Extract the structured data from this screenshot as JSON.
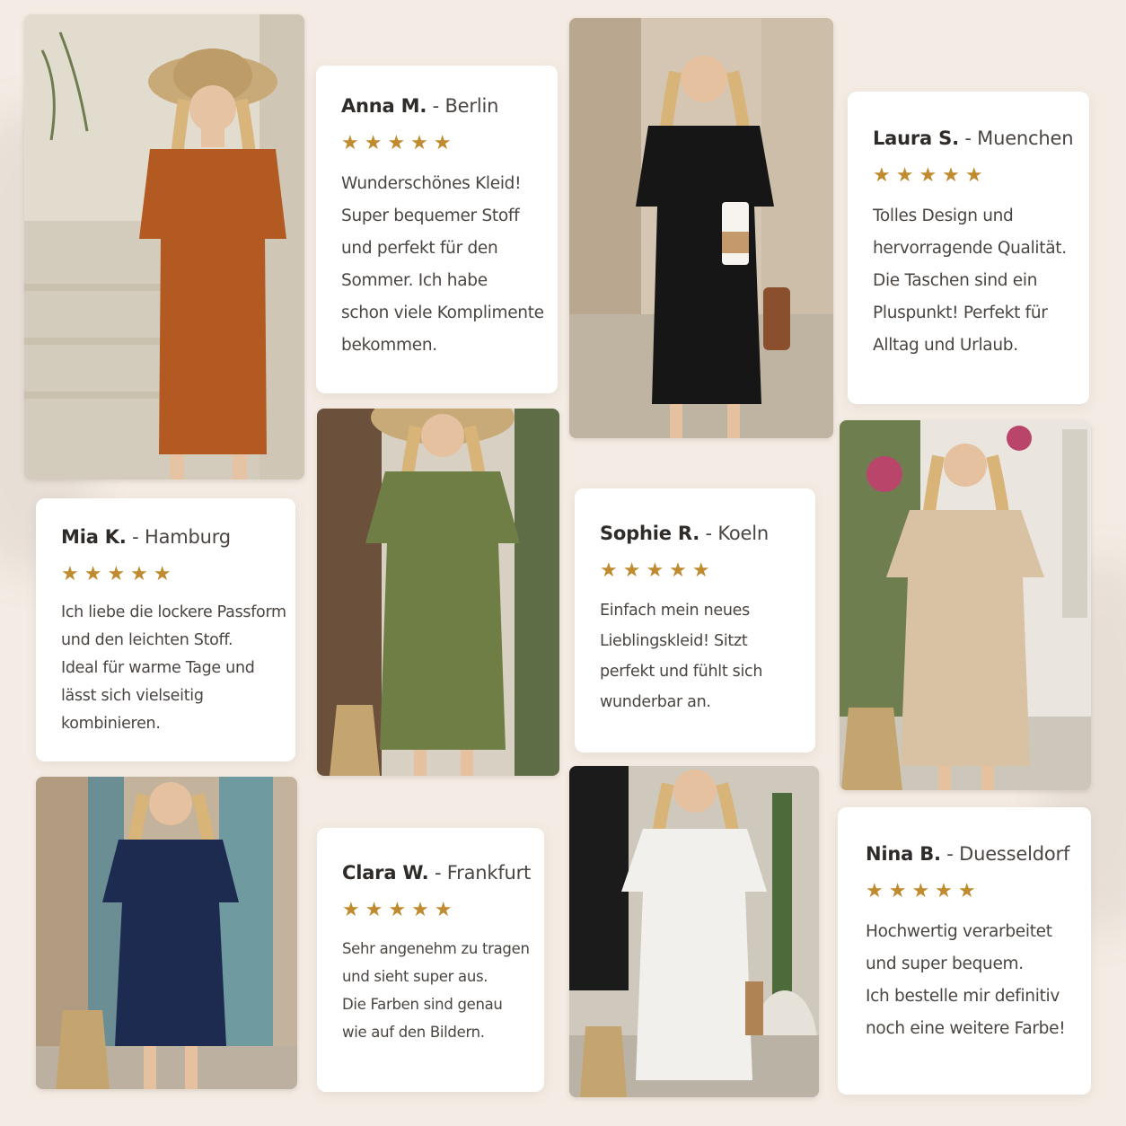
{
  "theme": {
    "background": "#f4ece4",
    "star_color": "#c08a2e",
    "card_color": "#ffffff"
  },
  "photos": [
    {
      "id": "terracotta",
      "dress_color": "#b35a23",
      "background": "#d9d2c5",
      "accessory": "straw-hat"
    },
    {
      "id": "black",
      "dress_color": "#161616",
      "background": "#c9b9a4",
      "accessory": "coffee-cup-and-bag"
    },
    {
      "id": "olive",
      "dress_color": "#6e7e45",
      "background": "#8c7d6a",
      "accessory": "straw-hat-and-basket"
    },
    {
      "id": "beige",
      "dress_color": "#d8c2a3",
      "background": "#a7a38b",
      "accessory": "straw-basket"
    },
    {
      "id": "navy",
      "dress_color": "#1c2b4f",
      "background": "#b7a690",
      "accessory": "straw-basket"
    },
    {
      "id": "white",
      "dress_color": "#f2f0ec",
      "background": "#bdb5a9",
      "accessory": "bag-and-basket"
    }
  ],
  "reviews": [
    {
      "name": "Anna M.",
      "city": "- Berlin",
      "stars": "★★★★★",
      "rating": 5,
      "lines": [
        "Wunderschönes Kleid!",
        "Super bequemer Stoff",
        "und perfekt für den",
        "Sommer. Ich habe",
        "schon viele Komplimente",
        "bekommen."
      ]
    },
    {
      "name": "Laura S.",
      "city": "- Muenchen",
      "stars": "★★★★★",
      "rating": 5,
      "lines": [
        "Tolles Design und",
        "hervorragende Qualität.",
        "Die Taschen sind ein",
        "Pluspunkt! Perfekt für",
        "Alltag und Urlaub."
      ]
    },
    {
      "name": "Mia K.",
      "city": "- Hamburg",
      "stars": "★★★★★",
      "rating": 5,
      "lines": [
        "Ich liebe die lockere Passform",
        "und den leichten Stoff.",
        "Ideal für warme Tage und",
        "lässt sich vielseitig",
        "kombinieren."
      ]
    },
    {
      "name": "Sophie R.",
      "city": "- Koeln",
      "stars": "★★★★★",
      "rating": 5,
      "lines": [
        "Einfach mein neues",
        "Lieblingskleid! Sitzt",
        "perfekt und fühlt sich",
        "wunderbar an."
      ]
    },
    {
      "name": "Clara W.",
      "city": "- Frankfurt",
      "stars": "★★★★★",
      "rating": 5,
      "lines": [
        "Sehr angenehm zu tragen",
        "und sieht super aus.",
        "Die Farben sind genau",
        "wie auf den Bildern."
      ]
    },
    {
      "name": "Nina B.",
      "city": "- Duesseldorf",
      "stars": "★★★★★",
      "rating": 5,
      "lines": [
        "Hochwertig verarbeitet",
        "und super bequem.",
        "Ich bestelle mir definitiv",
        "noch eine weitere Farbe!"
      ]
    }
  ]
}
